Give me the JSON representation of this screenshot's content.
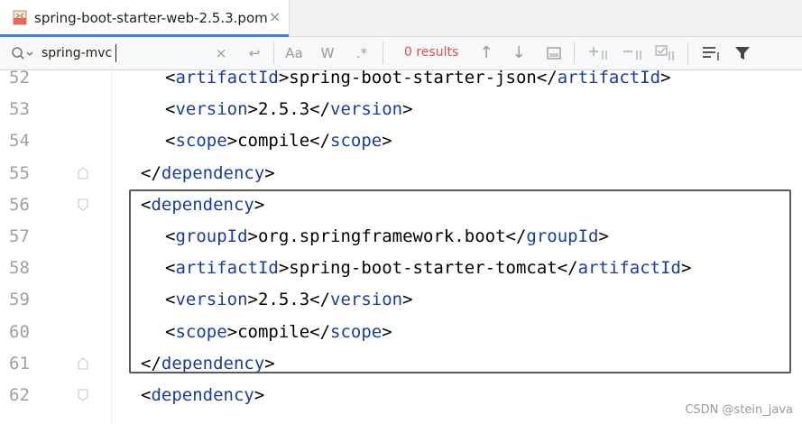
{
  "tab": {
    "title": "spring-boot-starter-web-2.5.3.pom",
    "close": "×"
  },
  "search": {
    "value": "spring-mvc",
    "clear": "×",
    "newline": "↩",
    "match_case": "Aa",
    "words": "W",
    "regex": ".*",
    "results": "0 results",
    "prev": "↑",
    "next": "↓"
  },
  "lines": [
    {
      "num": "52",
      "indent": 1,
      "parts": [
        "<",
        "artifactId",
        ">spring-boot-starter-json</",
        "artifactId",
        ">"
      ]
    },
    {
      "num": "53",
      "indent": 1,
      "parts": [
        "<",
        "version",
        ">2.5.3</",
        "version",
        ">"
      ]
    },
    {
      "num": "54",
      "indent": 1,
      "parts": [
        "<",
        "scope",
        ">compile</",
        "scope",
        ">"
      ]
    },
    {
      "num": "55",
      "indent": 0,
      "parts": [
        "</",
        "dependency",
        ">"
      ]
    },
    {
      "num": "56",
      "indent": 0,
      "parts": [
        "<",
        "dependency",
        ">"
      ]
    },
    {
      "num": "57",
      "indent": 1,
      "parts": [
        "<",
        "groupId",
        ">org.springframework.boot</",
        "groupId",
        ">"
      ]
    },
    {
      "num": "58",
      "indent": 1,
      "parts": [
        "<",
        "artifactId",
        ">spring-boot-starter-tomcat</",
        "artifactId",
        ">"
      ]
    },
    {
      "num": "59",
      "indent": 1,
      "parts": [
        "<",
        "version",
        ">2.5.3</",
        "version",
        ">"
      ]
    },
    {
      "num": "60",
      "indent": 1,
      "parts": [
        "<",
        "scope",
        ">compile</",
        "scope",
        ">"
      ]
    },
    {
      "num": "61",
      "indent": 0,
      "parts": [
        "</",
        "dependency",
        ">"
      ]
    },
    {
      "num": "62",
      "indent": 0,
      "parts": [
        "<",
        "dependency",
        ">"
      ]
    }
  ],
  "watermark": "CSDN @stein_java",
  "colors": {
    "tag": "#1a3d9c",
    "results": "#d8534f",
    "accent": "#4083c9"
  }
}
